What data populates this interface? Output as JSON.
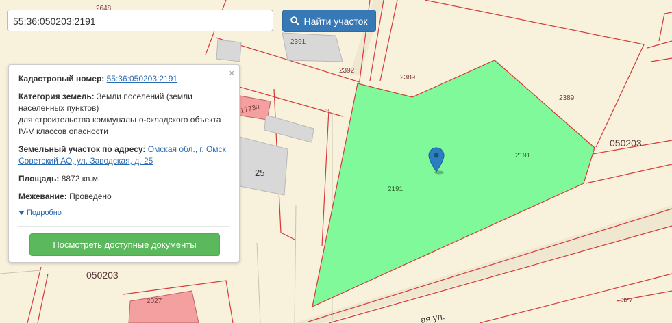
{
  "search": {
    "value": "55:36:050203:2191",
    "button_label": "Найти участок"
  },
  "map": {
    "labels": {
      "l_2648": "2648",
      "l_2391": "2391",
      "l_2392": "2392",
      "l_2389a": "2389",
      "l_2389b": "2389",
      "l_2191a": "2191",
      "l_2191b": "2191",
      "l_050203a": "050203",
      "l_050203b": "050203",
      "l_17730": "17730",
      "l_25": "25",
      "l_2027": "2027",
      "l_327": "327",
      "l_street": "ая ул."
    },
    "colors": {
      "selected_parcel": "#80f99a",
      "parcel_border": "#d43a3a",
      "marker": "#2b7fc0"
    }
  },
  "popup": {
    "cadastral_label": "Кадастровый номер:",
    "cadastral_value": "55:36:050203:2191",
    "category_label": "Категория земель:",
    "category_line1": "Земли поселений (земли",
    "category_line2": "населенных пунктов)",
    "category_line3": "для строительства коммунально-складского объекта",
    "category_line4": "IV-V классов опасности",
    "address_label": "Земельный участок по адресу:",
    "address_line1": "Омская обл., г. Омск,",
    "address_line2": "Советский АО, ул. Заводская, д. 25",
    "area_label": "Площадь:",
    "area_value": "8872 кв.м.",
    "survey_label": "Межевание:",
    "survey_value": "Проведено",
    "more_label": "Подробно",
    "docs_button": "Посмотреть доступные документы",
    "close_symbol": "×"
  }
}
